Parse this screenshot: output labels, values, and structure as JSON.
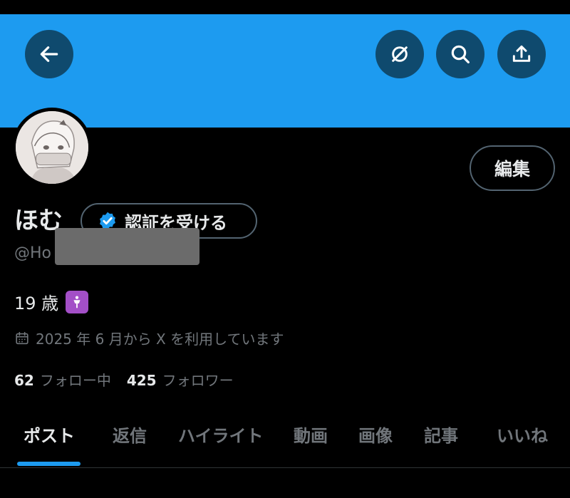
{
  "header": {
    "back_icon": "back-arrow-icon",
    "action_icons": [
      "grok-slash-icon",
      "search-icon",
      "share-upload-icon"
    ]
  },
  "profile": {
    "name": "ほむ",
    "verify_label": "認証を受ける",
    "handle": "@Ho",
    "edit_label": "編集",
    "bio": "19 歳",
    "joined": "2025 年 6 月から X を利用しています",
    "following_count": "62",
    "following_label": "フォロー中",
    "followers_count": "425",
    "followers_label": "フォロワー"
  },
  "tabs": [
    "ポスト",
    "返信",
    "ハイライト",
    "動画",
    "画像",
    "記事",
    "いいね"
  ],
  "colors": {
    "banner": "#1d9bf0",
    "accent": "#1d9bf0",
    "background": "#000000"
  }
}
